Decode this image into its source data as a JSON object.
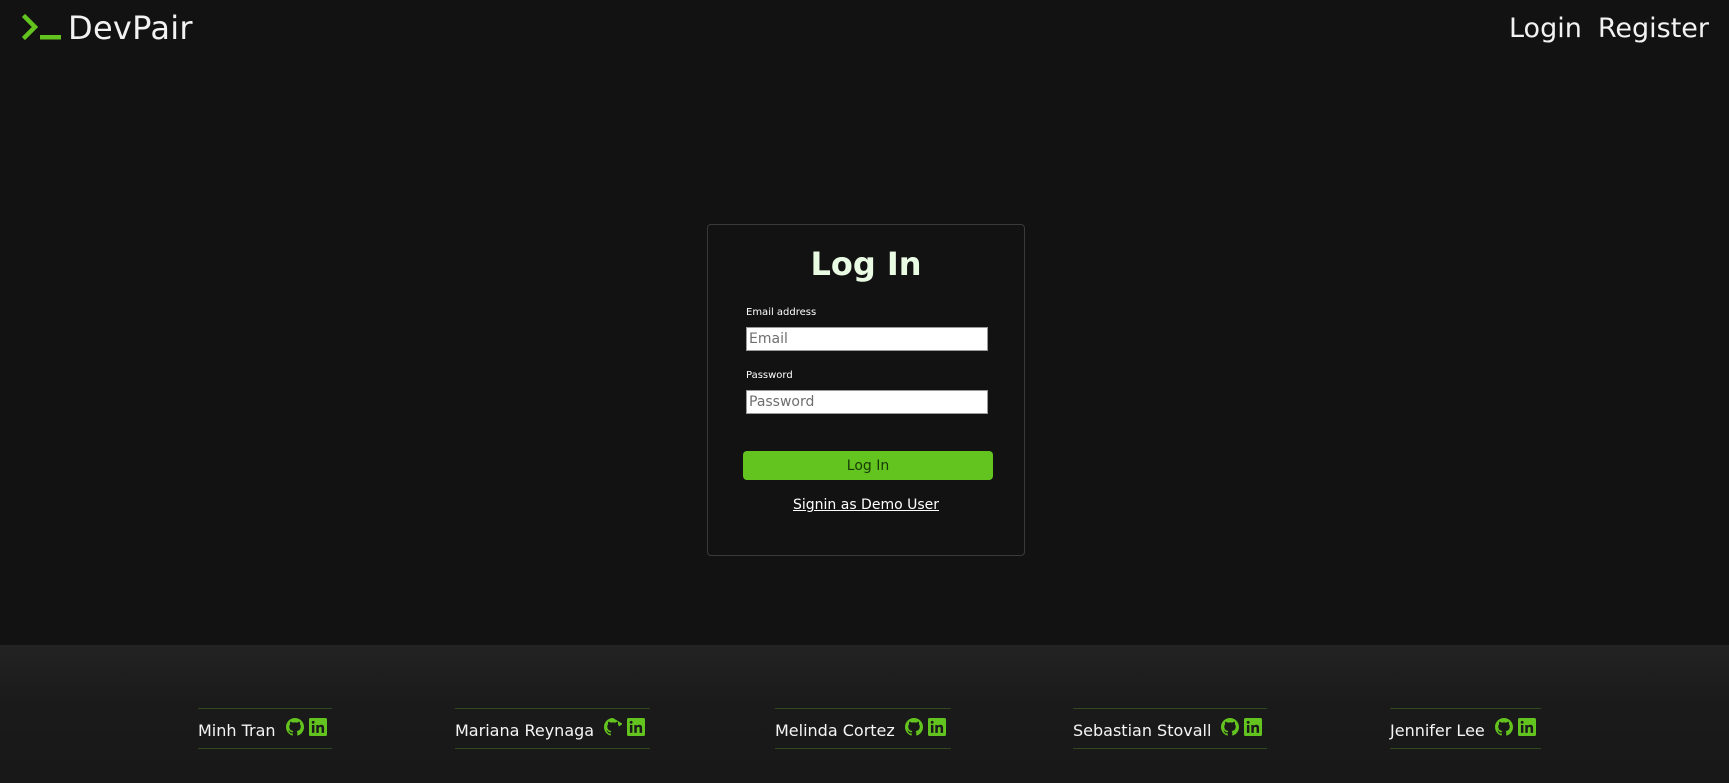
{
  "header": {
    "brand": "DevPair",
    "nav": {
      "login_label": "Login",
      "register_label": "Register"
    }
  },
  "login_form": {
    "title": "Log In",
    "email_label": "Email address",
    "email_placeholder": "Email",
    "email_value": "",
    "password_label": "Password",
    "password_placeholder": "Password",
    "password_value": "",
    "submit_label": "Log In",
    "demo_link_label": "Signin as Demo User"
  },
  "footer": {
    "members": [
      {
        "name": "Minh Tran",
        "icons": [
          "github-icon",
          "linkedin-icon"
        ]
      },
      {
        "name": "Mariana Reynaga",
        "icons": [
          "github-icon",
          "linkedin-icon"
        ]
      },
      {
        "name": "Melinda Cortez",
        "icons": [
          "github-icon",
          "linkedin-icon"
        ]
      },
      {
        "name": "Sebastian Stovall",
        "icons": [
          "github-icon",
          "linkedin-icon"
        ]
      },
      {
        "name": "Jennifer Lee",
        "icons": [
          "github-icon",
          "linkedin-icon"
        ]
      }
    ]
  },
  "colors": {
    "background": "#121212",
    "accent": "#64c41f",
    "title": "#eafbe4",
    "footer_bg": "#1a1a1a"
  }
}
